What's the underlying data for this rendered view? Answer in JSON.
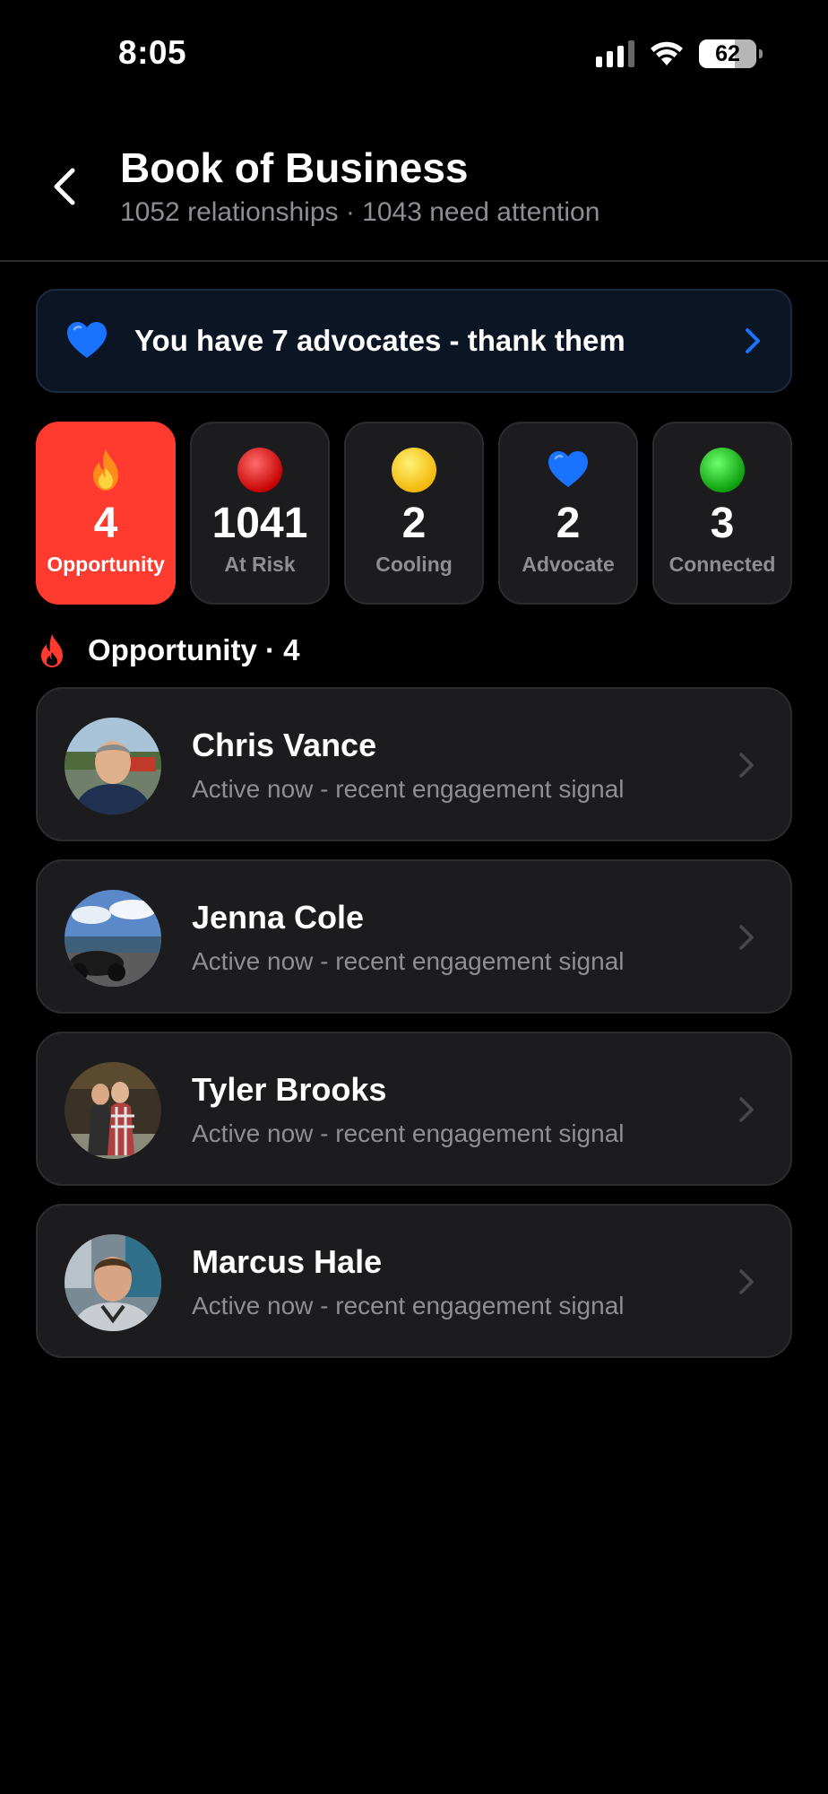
{
  "status": {
    "time": "8:05",
    "battery": "62"
  },
  "header": {
    "title": "Book of Business",
    "subtitle": "1052 relationships · 1043 need attention"
  },
  "banner": {
    "text": "You have 7 advocates - thank them"
  },
  "tiles": [
    {
      "count": "4",
      "label": "Opportunity",
      "icon": "fire-icon",
      "active": true
    },
    {
      "count": "1041",
      "label": "At Risk",
      "icon": "red-circle-icon"
    },
    {
      "count": "2",
      "label": "Cooling",
      "icon": "yellow-circle-icon"
    },
    {
      "count": "2",
      "label": "Advocate",
      "icon": "blue-heart-icon"
    },
    {
      "count": "3",
      "label": "Connected",
      "icon": "green-circle-icon"
    }
  ],
  "section": {
    "title": "Opportunity · 4"
  },
  "contacts": [
    {
      "name": "Chris Vance",
      "status": "Active now - recent engagement signal"
    },
    {
      "name": "Jenna Cole",
      "status": "Active now - recent engagement signal"
    },
    {
      "name": "Tyler Brooks",
      "status": "Active now - recent engagement signal"
    },
    {
      "name": "Marcus Hale",
      "status": "Active now - recent engagement signal"
    }
  ],
  "colors": {
    "accent_red": "#ff3b30",
    "advocate_blue": "#1a73ff",
    "card_bg": "#1c1c1e",
    "secondary_text": "#8e8e93"
  }
}
